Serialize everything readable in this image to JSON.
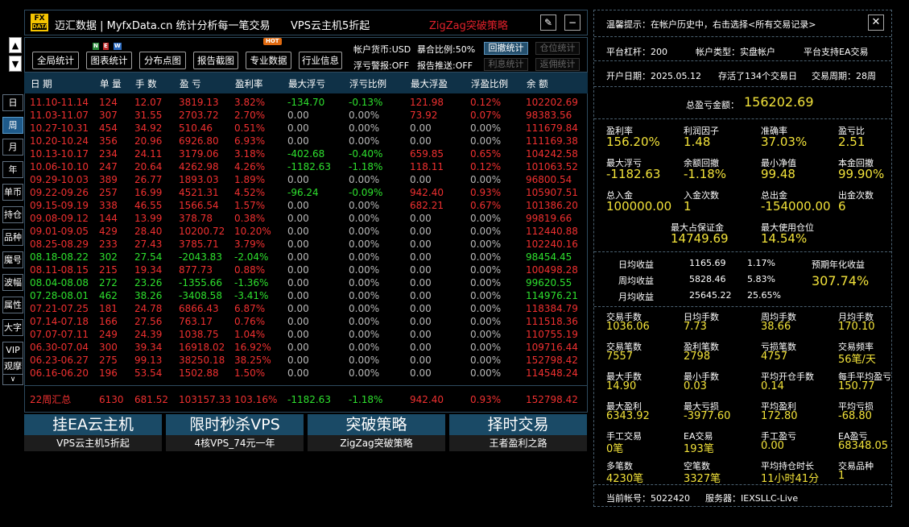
{
  "side": {
    "up": "▲",
    "down": "▼",
    "buttons": [
      "日",
      "周",
      "月",
      "年",
      "单币",
      "持仓",
      "品种",
      "魔号",
      "波幅",
      "属性",
      "大字",
      "VIP",
      "观摩"
    ],
    "more": "∨"
  },
  "title": {
    "logo_top": "FX",
    "logo_bottom": "DATA",
    "app": "迈汇数据 | MyfxData.cn  统计分析每一笔交易",
    "vps": "VPS云主机5折起",
    "zigzag": "ZigZag突破策略",
    "edit_icon": "✎",
    "min_icon": "−"
  },
  "toolbar": {
    "buttons": [
      "全局统计",
      "图表统计",
      "分布点图",
      "报告截图",
      "专业数据",
      "行业信息"
    ],
    "new_badge": [
      "N",
      "E",
      "W"
    ],
    "hot_badge": "HOT",
    "currency": "帐户货币:USD",
    "exposure": "暴合比例:50%",
    "float_alarm": "浮亏警报:OFF",
    "report_push": "报告推送:OFF",
    "small_buttons": [
      "回撤统计",
      "仓位统计",
      "利息统计",
      "返佣统计"
    ]
  },
  "table": {
    "headers": [
      "日 期",
      "单 量",
      "手 数",
      "盈 亏",
      "盈利率",
      "最大浮亏",
      "浮亏比例",
      "最大浮盈",
      "浮盈比例",
      "余 额"
    ],
    "rows": [
      [
        "11.10-11.14",
        "124",
        "12.07",
        "3819.13",
        "3.82%",
        "-134.70",
        "-0.13%",
        "121.98",
        "0.12%",
        "102202.69"
      ],
      [
        "11.03-11.07",
        "307",
        "31.55",
        "2703.72",
        "2.70%",
        "0.00",
        "0.00%",
        "73.92",
        "0.07%",
        "98383.56"
      ],
      [
        "10.27-10.31",
        "454",
        "34.92",
        "510.46",
        "0.51%",
        "0.00",
        "0.00%",
        "0.00",
        "0.00%",
        "111679.84"
      ],
      [
        "10.20-10.24",
        "356",
        "20.96",
        "6926.80",
        "6.93%",
        "0.00",
        "0.00%",
        "0.00",
        "0.00%",
        "111169.38"
      ],
      [
        "10.13-10.17",
        "234",
        "24.11",
        "3179.06",
        "3.18%",
        "-402.68",
        "-0.40%",
        "659.85",
        "0.65%",
        "104242.58"
      ],
      [
        "10.06-10.10",
        "247",
        "20.64",
        "4262.98",
        "4.26%",
        "-1182.63",
        "-1.18%",
        "118.11",
        "0.12%",
        "101063.52"
      ],
      [
        "09.29-10.03",
        "389",
        "26.77",
        "1893.03",
        "1.89%",
        "0.00",
        "0.00%",
        "0.00",
        "0.00%",
        "96800.54"
      ],
      [
        "09.22-09.26",
        "257",
        "16.99",
        "4521.31",
        "4.52%",
        "-96.24",
        "-0.09%",
        "942.40",
        "0.93%",
        "105907.51"
      ],
      [
        "09.15-09.19",
        "338",
        "46.55",
        "1566.54",
        "1.57%",
        "0.00",
        "0.00%",
        "682.21",
        "0.67%",
        "101386.20"
      ],
      [
        "09.08-09.12",
        "144",
        "13.99",
        "378.78",
        "0.38%",
        "0.00",
        "0.00%",
        "0.00",
        "0.00%",
        "99819.66"
      ],
      [
        "09.01-09.05",
        "429",
        "28.40",
        "10200.72",
        "10.20%",
        "0.00",
        "0.00%",
        "0.00",
        "0.00%",
        "112440.88"
      ],
      [
        "08.25-08.29",
        "233",
        "27.43",
        "3785.71",
        "3.79%",
        "0.00",
        "0.00%",
        "0.00",
        "0.00%",
        "102240.16"
      ],
      [
        "08.18-08.22",
        "302",
        "27.54",
        "-2043.83",
        "-2.04%",
        "0.00",
        "0.00%",
        "0.00",
        "0.00%",
        "98454.45"
      ],
      [
        "08.11-08.15",
        "215",
        "19.34",
        "877.73",
        "0.88%",
        "0.00",
        "0.00%",
        "0.00",
        "0.00%",
        "100498.28"
      ],
      [
        "08.04-08.08",
        "272",
        "23.26",
        "-1355.66",
        "-1.36%",
        "0.00",
        "0.00%",
        "0.00",
        "0.00%",
        "99620.55"
      ],
      [
        "07.28-08.01",
        "462",
        "38.26",
        "-3408.58",
        "-3.41%",
        "0.00",
        "0.00%",
        "0.00",
        "0.00%",
        "114976.21"
      ],
      [
        "07.21-07.25",
        "181",
        "24.78",
        "6866.43",
        "6.87%",
        "0.00",
        "0.00%",
        "0.00",
        "0.00%",
        "118384.79"
      ],
      [
        "07.14-07.18",
        "166",
        "27.56",
        "763.17",
        "0.76%",
        "0.00",
        "0.00%",
        "0.00",
        "0.00%",
        "111518.36"
      ],
      [
        "07.07-07.11",
        "249",
        "24.39",
        "1038.75",
        "1.04%",
        "0.00",
        "0.00%",
        "0.00",
        "0.00%",
        "110755.19"
      ],
      [
        "06.30-07.04",
        "300",
        "39.34",
        "16918.02",
        "16.92%",
        "0.00",
        "0.00%",
        "0.00",
        "0.00%",
        "109716.44"
      ],
      [
        "06.23-06.27",
        "275",
        "99.13",
        "38250.18",
        "38.25%",
        "0.00",
        "0.00%",
        "0.00",
        "0.00%",
        "152798.42"
      ],
      [
        "06.16-06.20",
        "196",
        "53.54",
        "1502.88",
        "1.50%",
        "0.00",
        "0.00%",
        "0.00",
        "0.00%",
        "114548.24"
      ]
    ],
    "summary": [
      "22周汇总",
      "6130",
      "681.52",
      "103157.33",
      "103.16%",
      "-1182.63",
      "-1.18%",
      "942.40",
      "0.93%",
      "152798.42"
    ]
  },
  "ads": [
    {
      "big": "挂EA云主机",
      "small": "VPS云主机5折起"
    },
    {
      "big": "限时秒杀VPS",
      "small": "4核VPS_74元一年"
    },
    {
      "big": "突破策略",
      "small": "ZigZag突破策略"
    },
    {
      "big": "择时交易",
      "small": "王者盈利之路"
    }
  ],
  "panel": {
    "tip": "温馨提示：在帐户历史中，右击选择<所有交易记录>",
    "close_icon": "✕",
    "leverage": "平台杠杆：200",
    "account_type": "帐户类型：实盘帐户",
    "ea_support": "平台支持EA交易",
    "open_date": "开户日期：2025.05.12",
    "stored": "存活了134个交易日",
    "cycle": "交易周期：28周",
    "total_label": "总盈亏金额：",
    "total_value": "156202.69",
    "g1": [
      {
        "l": "盈利率",
        "v": "156.20%"
      },
      {
        "l": "利润因子",
        "v": "1.48"
      },
      {
        "l": "准确率",
        "v": "37.03%"
      },
      {
        "l": "盈亏比",
        "v": "2.51"
      },
      {
        "l": "最大浮亏",
        "v": "-1182.63"
      },
      {
        "l": "余额回撤",
        "v": "-1.18%"
      },
      {
        "l": "最小净值",
        "v": "99.48"
      },
      {
        "l": "本金回撤",
        "v": "99.90%"
      },
      {
        "l": "总入金",
        "v": "100000.00"
      },
      {
        "l": "入金次数",
        "v": "1"
      },
      {
        "l": "总出金",
        "v": "-154000.00"
      },
      {
        "l": "出金次数",
        "v": "6"
      }
    ],
    "margin": [
      {
        "l": "最大占保证金",
        "v": "14749.69"
      },
      {
        "l": "最大使用仓位",
        "v": "14.54%"
      }
    ],
    "returns": {
      "rows": [
        {
          "l": "日均收益",
          "a": "1165.69",
          "p": "1.17%"
        },
        {
          "l": "周均收益",
          "a": "5828.46",
          "p": "5.83%"
        },
        {
          "l": "月均收益",
          "a": "25645.22",
          "p": "25.65%"
        }
      ],
      "annual_label": "预期年化收益",
      "annual_value": "307.74%"
    },
    "g2": [
      {
        "l": "交易手数",
        "v": "1036.06"
      },
      {
        "l": "日均手数",
        "v": "7.73"
      },
      {
        "l": "周均手数",
        "v": "38.66"
      },
      {
        "l": "月均手数",
        "v": "170.10"
      },
      {
        "l": "交易笔数",
        "v": "7557"
      },
      {
        "l": "盈利笔数",
        "v": "2798"
      },
      {
        "l": "亏损笔数",
        "v": "4757"
      },
      {
        "l": "交易频率",
        "v": "56笔/天"
      },
      {
        "l": "最大手数",
        "v": "14.90"
      },
      {
        "l": "最小手数",
        "v": "0.03"
      },
      {
        "l": "平均开仓手数",
        "v": "0.14"
      },
      {
        "l": "每手平均盈亏",
        "v": "150.77"
      },
      {
        "l": "最大盈利",
        "v": "6343.92"
      },
      {
        "l": "最大亏损",
        "v": "-3977.60"
      },
      {
        "l": "平均盈利",
        "v": "172.80"
      },
      {
        "l": "平均亏损",
        "v": "-68.80"
      },
      {
        "l": "手工交易",
        "v": "0笔"
      },
      {
        "l": "EA交易",
        "v": "193笔"
      },
      {
        "l": "手工盈亏",
        "v": "0.00"
      },
      {
        "l": "EA盈亏",
        "v": "68348.05"
      },
      {
        "l": "多笔数",
        "v": "4230笔"
      },
      {
        "l": "空笔数",
        "v": "3327笔"
      },
      {
        "l": "平均持仓时长",
        "v": "11小时41分"
      },
      {
        "l": "交易品种",
        "v": "1"
      }
    ],
    "account_no": "当前帐号：5022420",
    "server": "服务器：IEXSLLC-Live"
  },
  "colors": {
    "profit": "#f03030",
    "loss": "#2ee02e",
    "neutral": "#b8b8b8",
    "accent": "#f2e23a",
    "header_bg": "#0f3147",
    "ad_bg": "#1a4a66"
  }
}
